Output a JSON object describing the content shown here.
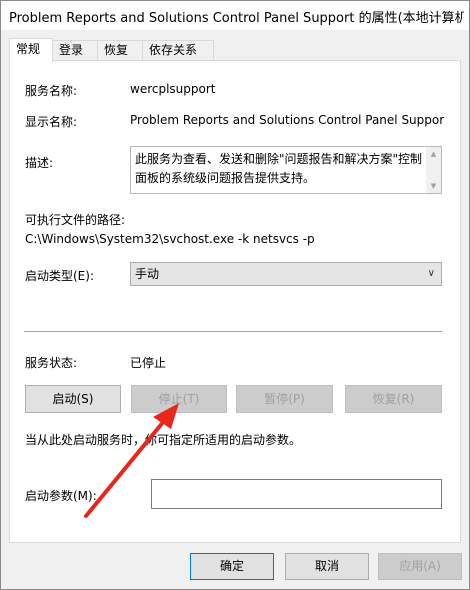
{
  "window": {
    "title": "Problem Reports and Solutions Control Panel Support 的属性(本地计算机)"
  },
  "tabs": [
    {
      "label": "常规",
      "active": true
    },
    {
      "label": "登录",
      "active": false
    },
    {
      "label": "恢复",
      "active": false
    },
    {
      "label": "依存关系",
      "active": false
    }
  ],
  "general": {
    "service_name_label": "服务名称:",
    "service_name": "wercplsupport",
    "display_name_label": "显示名称:",
    "display_name": "Problem Reports and Solutions Control Panel Suppor",
    "description_label": "描述:",
    "description": "此服务为查看、发送和删除\"问题报告和解决方案\"控制面板的系统级问题报告提供支持。",
    "exe_path_label": "可执行文件的路径:",
    "exe_path": "C:\\Windows\\System32\\svchost.exe -k netsvcs -p",
    "startup_type_label": "启动类型(E):",
    "startup_type": "手动",
    "status_label": "服务状态:",
    "status": "已停止",
    "hint": "当从此处启动服务时，你可指定所适用的启动参数。",
    "start_params_label": "启动参数(M):",
    "start_params_value": ""
  },
  "service_buttons": {
    "start": "启动(S)",
    "stop": "停止(T)",
    "pause": "暂停(P)",
    "resume": "恢复(R)"
  },
  "dialog_buttons": {
    "ok": "确定",
    "cancel": "取消",
    "apply": "应用(A)"
  },
  "colors": {
    "annotation_arrow": "#e8261c",
    "focus_border": "#0078d7"
  }
}
